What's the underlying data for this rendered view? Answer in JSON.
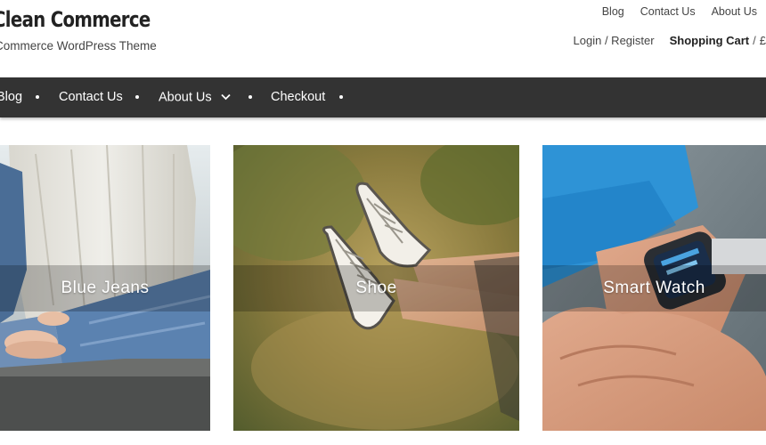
{
  "site": {
    "title": "Clean Commerce",
    "tagline": "Commerce WordPress Theme"
  },
  "top_links": {
    "blog": "Blog",
    "contact": "Contact Us",
    "about": "About Us"
  },
  "account": {
    "login_register": "Login / Register",
    "cart_label": "Shopping Cart",
    "separator": "/",
    "cart_total": "£"
  },
  "nav": {
    "items": [
      {
        "label": "Blog"
      },
      {
        "label": "Contact Us"
      },
      {
        "label": "About Us",
        "icon": "chevron-down-icon"
      },
      {
        "label": "Checkout"
      }
    ]
  },
  "tiles": [
    {
      "label": "Blue Jeans"
    },
    {
      "label": "Shoe"
    },
    {
      "label": "Smart Watch"
    }
  ],
  "colors": {
    "navbar": "#333333",
    "nav_text": "#ffffff",
    "overlay_text": "#ffffff"
  }
}
